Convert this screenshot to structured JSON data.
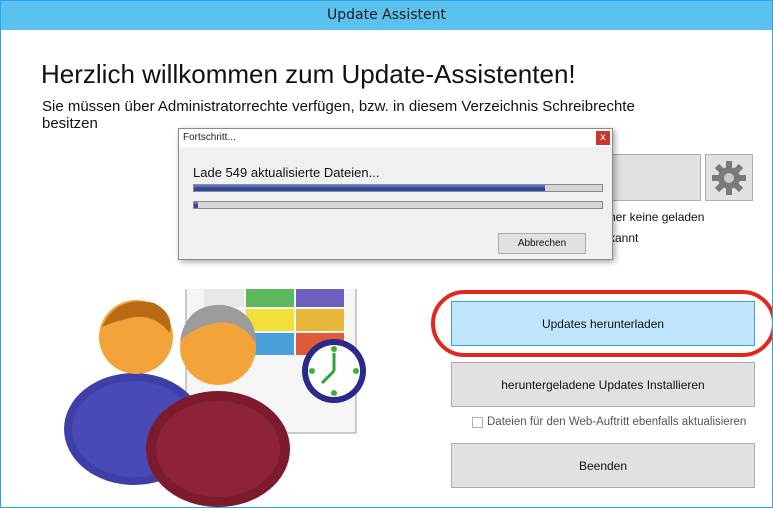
{
  "window": {
    "title": "Update Assistent"
  },
  "main": {
    "heading": "Herzlich willkommen zum Update-Assistenten!",
    "subtext": "Sie müssen über Administratorrechte verfügen, bzw. in diesem Verzeichnis Schreibrechte besitzen",
    "info_line1": "her keine geladen",
    "info_line2": "kannt"
  },
  "buttons": {
    "download": "Updates herunterladen",
    "install": "heruntergeladene Updates Installieren",
    "exit": "Beenden"
  },
  "checkbox": {
    "label": "Dateien für den Web-Auftritt ebenfalls aktualisieren",
    "checked": false
  },
  "progress_dialog": {
    "title": "Fortschritt...",
    "close": "x",
    "status": "Lade 549 aktualisierte Dateien...",
    "progress_main": 0.86,
    "progress_file": 0.01,
    "cancel": "Abbrechen"
  },
  "colors": {
    "accent": "#5bc2ef",
    "highlight": "#e0281e",
    "download_bg": "#bfe5fb"
  },
  "icons": [
    "gear-icon",
    "users-icon",
    "clock-icon",
    "calendar-icon"
  ]
}
